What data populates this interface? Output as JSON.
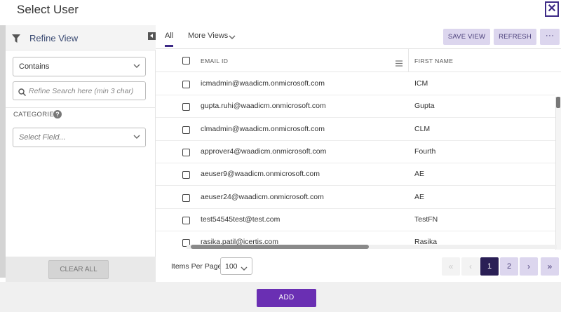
{
  "dialog": {
    "title": "Select User",
    "close_label": "✕"
  },
  "left_panel": {
    "title": "Refine View",
    "operator_select": "Contains",
    "search_placeholder": "Refine Search here (min 3 char)",
    "categories_label": "CATEGORIES",
    "field_select_placeholder": "Select Field...",
    "clear_all": "CLEAR ALL"
  },
  "toolbar": {
    "tab_all": "All",
    "tab_more_views": "More Views",
    "save_view": "SAVE VIEW",
    "refresh": "REFRESH",
    "more": "···"
  },
  "table": {
    "columns": [
      "EMAIL ID",
      "FIRST NAME"
    ],
    "rows": [
      {
        "email": "icmadmin@waadicm.onmicrosoft.com",
        "first_name": "ICM"
      },
      {
        "email": "gupta.ruhi@waadicm.onmicrosoft.com",
        "first_name": "Gupta"
      },
      {
        "email": "clmadmin@waadicm.onmicrosoft.com",
        "first_name": "CLM"
      },
      {
        "email": "approver4@waadicm.onmicrosoft.com",
        "first_name": "Fourth"
      },
      {
        "email": "aeuser9@waadicm.onmicrosoft.com",
        "first_name": "AE"
      },
      {
        "email": "aeuser24@waadicm.onmicrosoft.com",
        "first_name": "AE"
      },
      {
        "email": "test54545test@test.com",
        "first_name": "TestFN"
      },
      {
        "email": "rasika.patil@icertis.com",
        "first_name": "Rasika"
      }
    ]
  },
  "pagination": {
    "items_per_page_label": "Items Per Page",
    "items_per_page": "100",
    "first": "«",
    "prev": "‹",
    "pages": [
      "1",
      "2"
    ],
    "current_page": "1",
    "next": "›",
    "last": "»"
  },
  "footer": {
    "add": "ADD"
  },
  "colors": {
    "brand": "#3d2a86",
    "add_button": "#6a2fb3",
    "active_page": "#2a1f55",
    "secondary_button": "#dcd6ee"
  }
}
